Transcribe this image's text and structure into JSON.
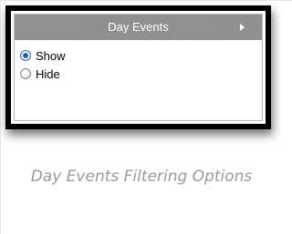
{
  "panel": {
    "header": {
      "title": "Day Events",
      "expand_icon": "chevron-right-icon"
    },
    "options": [
      {
        "label": "Show",
        "selected": true
      },
      {
        "label": "Hide",
        "selected": false
      }
    ]
  },
  "caption": "Day Events Filtering Options",
  "colors": {
    "header_bg": "#8e8e8e",
    "frame_border": "#000000",
    "caption_text": "#9a9a9a"
  }
}
